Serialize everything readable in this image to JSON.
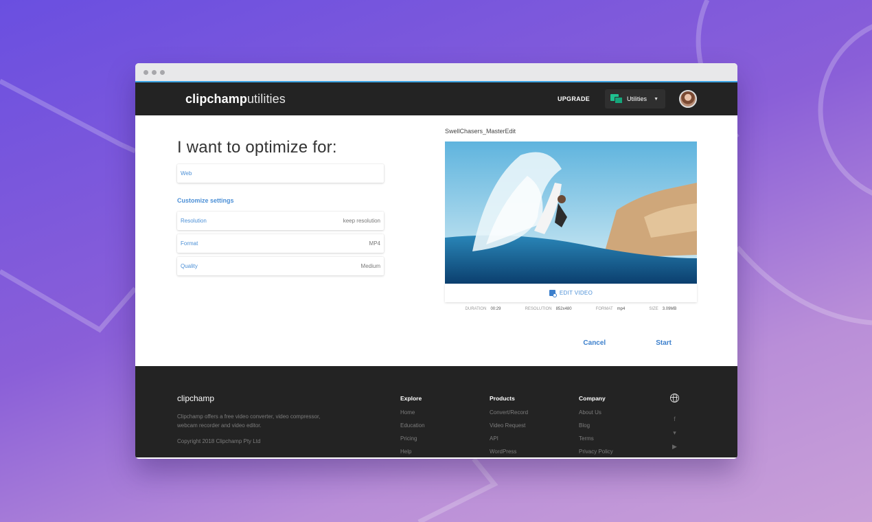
{
  "app": {
    "logo_bold": "clipchamp",
    "logo_thin": "utilities",
    "upgrade_label": "UPGRADE",
    "utilities_label": "Utilities",
    "avatar": "user-avatar"
  },
  "left": {
    "heading": "I want to optimize for:",
    "optimize_value": "Web",
    "customize_label": "Customize settings",
    "settings": [
      {
        "label": "Resolution",
        "value": "keep resolution"
      },
      {
        "label": "Format",
        "value": "MP4"
      },
      {
        "label": "Quality",
        "value": "Medium"
      }
    ]
  },
  "preview": {
    "filename": "SwellChasers_MasterEdit",
    "edit_label": "EDIT VIDEO",
    "meta": [
      {
        "key": "Duration",
        "value": "00:29"
      },
      {
        "key": "Resolution",
        "value": "852x480"
      },
      {
        "key": "Format",
        "value": "mp4"
      },
      {
        "key": "Size",
        "value": "3.09MB"
      }
    ]
  },
  "actions": {
    "cancel": "Cancel",
    "start": "Start"
  },
  "footer": {
    "logo": "clipchamp",
    "description": "Clipchamp offers a free video converter, video compressor, webcam recorder and video editor.",
    "copyright": "Copyright 2018 Clipchamp Pty Ltd",
    "columns": [
      {
        "title": "Explore",
        "items": [
          "Home",
          "Education",
          "Pricing",
          "Help"
        ]
      },
      {
        "title": "Products",
        "items": [
          "Convert/Record",
          "Video Request",
          "API",
          "WordPress"
        ]
      },
      {
        "title": "Company",
        "items": [
          "About Us",
          "Blog",
          "Terms",
          "Privacy Policy"
        ]
      }
    ],
    "social_icons": [
      "globe-icon",
      "facebook-icon",
      "twitter-icon",
      "youtube-icon"
    ]
  },
  "colors": {
    "accent": "#4b8fd6",
    "topbar": "#232323",
    "utilities_green": "#1fc190",
    "chrome_line": "#3aa3e3"
  }
}
